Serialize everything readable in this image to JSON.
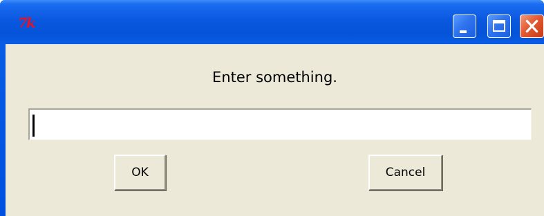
{
  "window": {
    "title": "",
    "app_icon_label": "7k",
    "title_buttons": [
      {
        "name": "minimize",
        "icon": "minimize-icon"
      },
      {
        "name": "maximize",
        "icon": "maximize-icon"
      },
      {
        "name": "close",
        "icon": "close-icon"
      }
    ]
  },
  "dialog": {
    "prompt": "Enter something.",
    "input_value": "",
    "ok_label": "OK",
    "cancel_label": "Cancel"
  },
  "colors": {
    "titlebar": "#0b58e0",
    "client_background": "#ece9d8",
    "close_button": "#e25a33"
  }
}
